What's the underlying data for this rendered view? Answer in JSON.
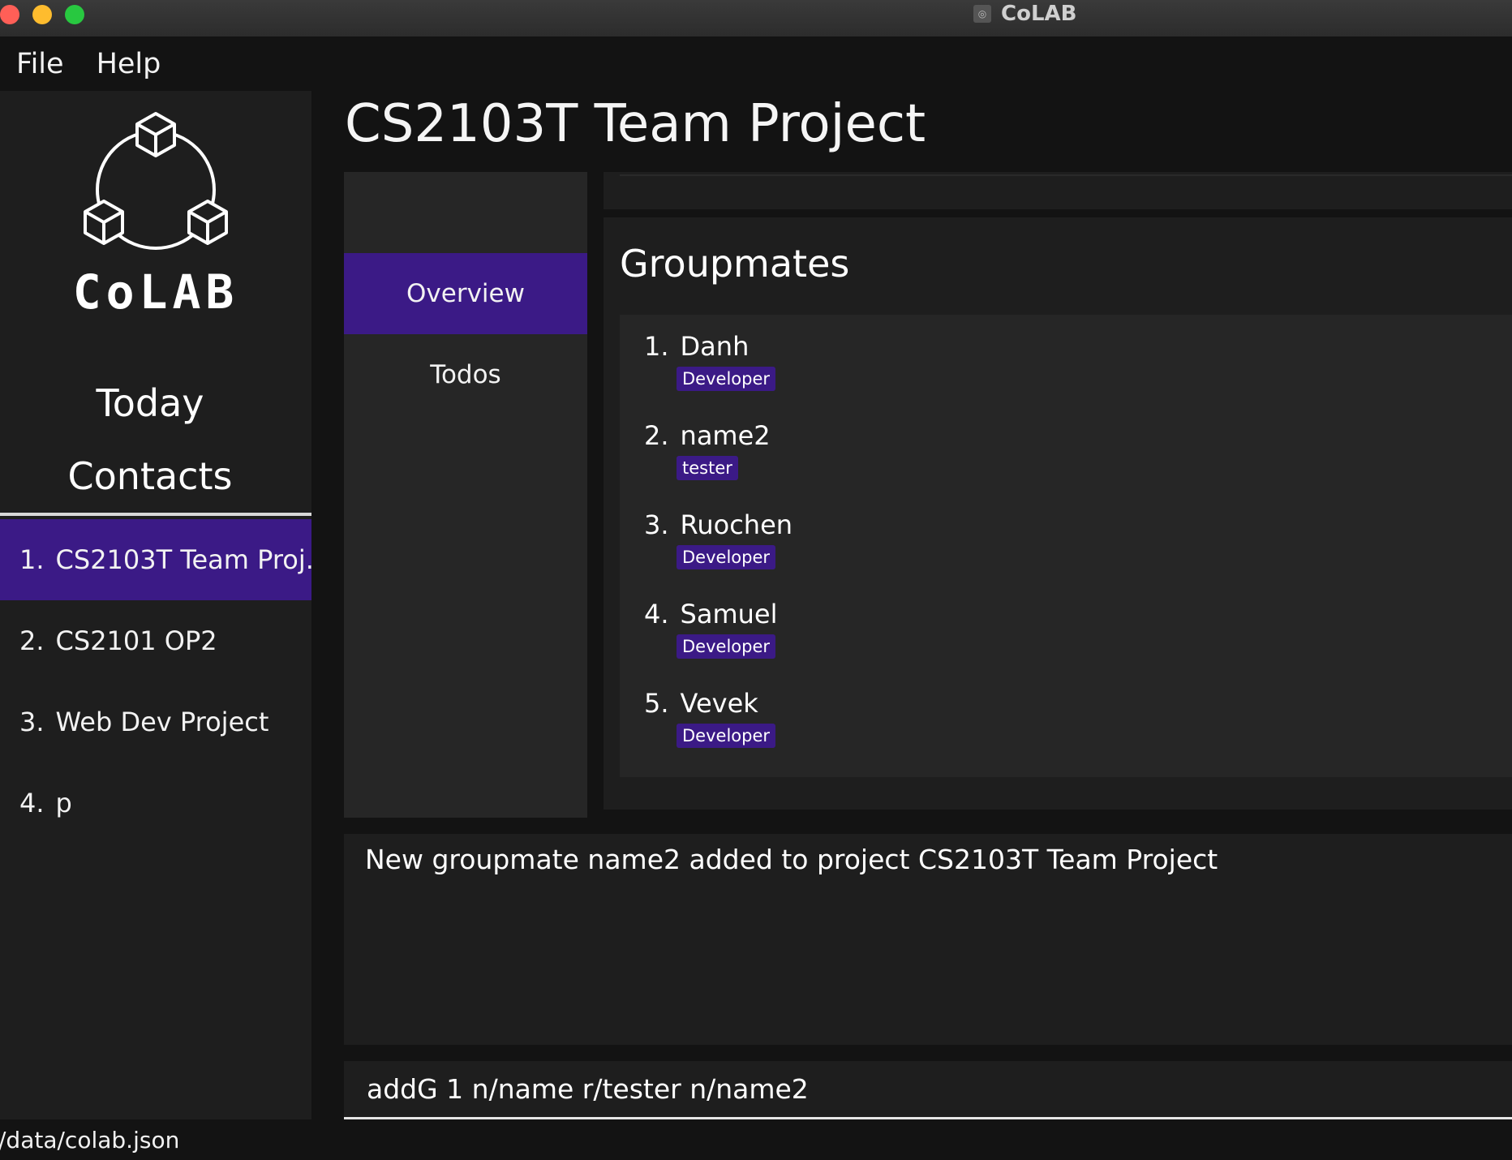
{
  "window": {
    "title": "CoLAB",
    "app_icon": "colab-app-icon"
  },
  "menu": {
    "items": [
      "File",
      "Help"
    ]
  },
  "sidebar": {
    "logo_text": "CoLAB",
    "nav": {
      "today": "Today",
      "contacts": "Contacts"
    },
    "projects": [
      {
        "index": "1.",
        "name": "CS2103T Team Proj...",
        "selected": true
      },
      {
        "index": "2.",
        "name": "CS2101 OP2",
        "selected": false
      },
      {
        "index": "3.",
        "name": "Web Dev Project",
        "selected": false
      },
      {
        "index": "4.",
        "name": "p",
        "selected": false
      }
    ]
  },
  "main": {
    "title": "CS2103T Team Project",
    "tabs": [
      {
        "label": "Overview",
        "active": true
      },
      {
        "label": "Todos",
        "active": false
      }
    ],
    "groupmates": {
      "title": "Groupmates",
      "items": [
        {
          "index": "1.",
          "name": "Danh",
          "role": "Developer"
        },
        {
          "index": "2.",
          "name": "name2",
          "role": "tester"
        },
        {
          "index": "3.",
          "name": "Ruochen",
          "role": "Developer"
        },
        {
          "index": "4.",
          "name": "Samuel",
          "role": "Developer"
        },
        {
          "index": "5.",
          "name": "Vevek",
          "role": "Developer"
        }
      ]
    },
    "result_message": "New groupmate name2 added to project CS2103T Team Project",
    "command": {
      "value": "addG 1 n/name r/tester n/name2"
    }
  },
  "status_bar": {
    "path": "/data/colab.json"
  },
  "colors": {
    "accent": "#3b1a86",
    "background": "#131313",
    "panel": "#1e1e1e",
    "panel_alt": "#262626"
  }
}
